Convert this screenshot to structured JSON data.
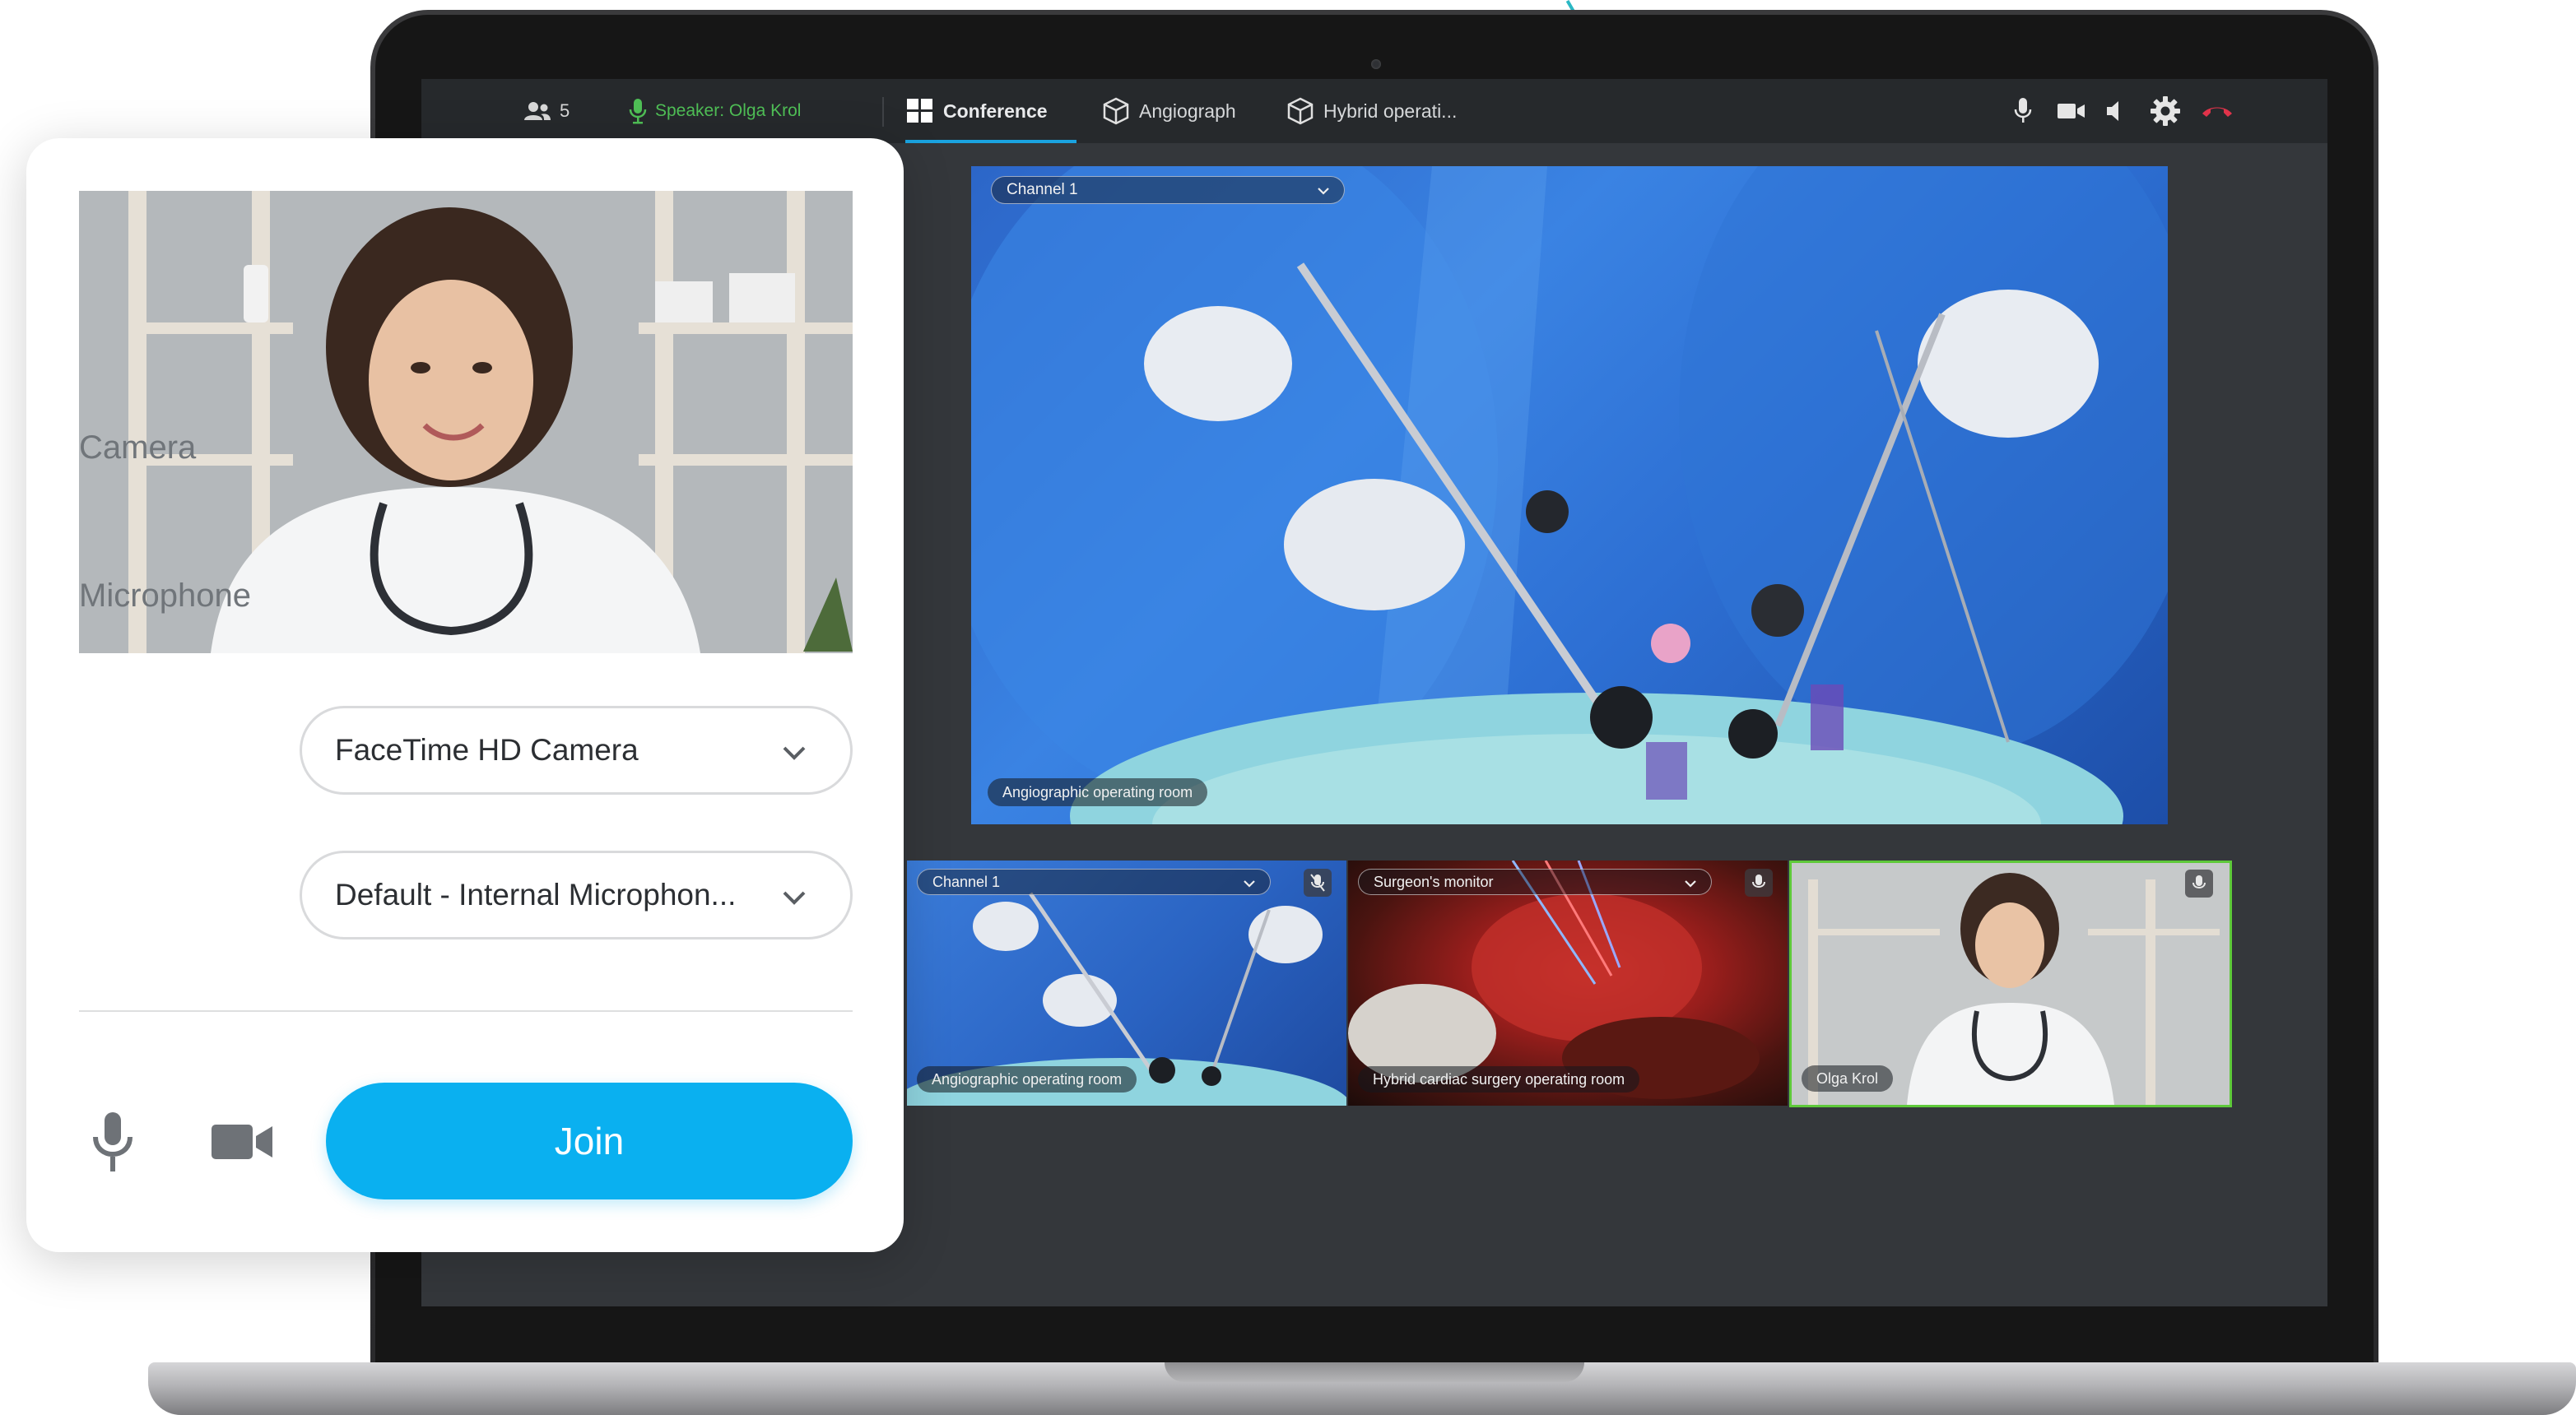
{
  "conference": {
    "participants_count": "5",
    "speaker_label": "Speaker: Olga Krol",
    "tabs": [
      {
        "label": "Conference",
        "icon": "grid-icon",
        "active": true
      },
      {
        "label": "Angiograph",
        "icon": "cube-icon",
        "active": false
      },
      {
        "label": "Hybrid operati...",
        "icon": "cube-icon",
        "active": false
      }
    ],
    "controls": [
      "microphone-icon",
      "camera-icon",
      "speaker-icon",
      "settings-icon",
      "hangup-icon"
    ],
    "main_video": {
      "channel_label": "Channel 1",
      "room_label": "Angiographic operating room"
    },
    "thumbnails": [
      {
        "channel_label": "Channel 1",
        "room_label": "Angiographic operating room",
        "mic": "muted"
      },
      {
        "channel_label": "Surgeon's monitor",
        "room_label": "Hybrid cardiac surgery operating room",
        "mic": "on"
      },
      {
        "name_label": "Olga Krol",
        "mic": "on",
        "highlighted": true
      }
    ]
  },
  "join_panel": {
    "camera_label": "Camera",
    "camera_value": "FaceTime HD Camera",
    "microphone_label": "Microphone",
    "microphone_value": "Default - Internal Microphon...",
    "join_label": "Join"
  },
  "colors": {
    "accent": "#0ab0f0",
    "speaker_green": "#4fbf56",
    "hangup_red": "#e0334a",
    "active_tab_underline": "#1aa3e0",
    "speaking_border": "#5ec93a"
  }
}
